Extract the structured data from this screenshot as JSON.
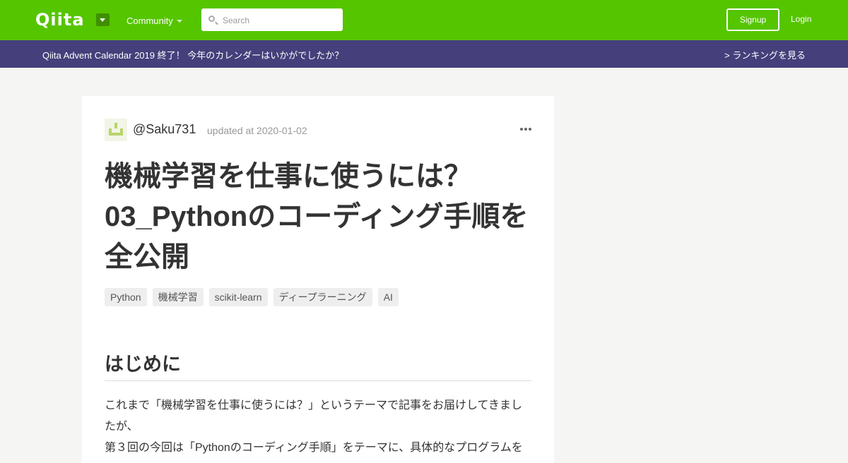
{
  "header": {
    "logo": "Qiita",
    "community_label": "Community",
    "search_placeholder": "Search",
    "signup_label": "Signup",
    "login_label": "Login",
    "brand_color": "#55c500"
  },
  "banner": {
    "text": "Qiita Advent Calendar 2019 終了！ 今年のカレンダーはいかがでしたか？",
    "link": "> ランキングを見る",
    "color": "#453f7b"
  },
  "article": {
    "author": "@Saku731",
    "updated": "updated at 2020-01-02",
    "title": "機械学習を仕事に使うには？ 03_Pythonのコーディング手順を全公開",
    "tags": [
      "Python",
      "機械学習",
      "scikit-learn",
      "ディープラーニング",
      "AI"
    ],
    "section_heading": "はじめに",
    "paragraph": "これまで「機械学習を仕事に使うには？」というテーマで記事をお届けしてきましたが、",
    "paragraph_cut": "第３回の今回は「Pythonのコーディング手順」をテーマに、具体的なプログラムを"
  }
}
